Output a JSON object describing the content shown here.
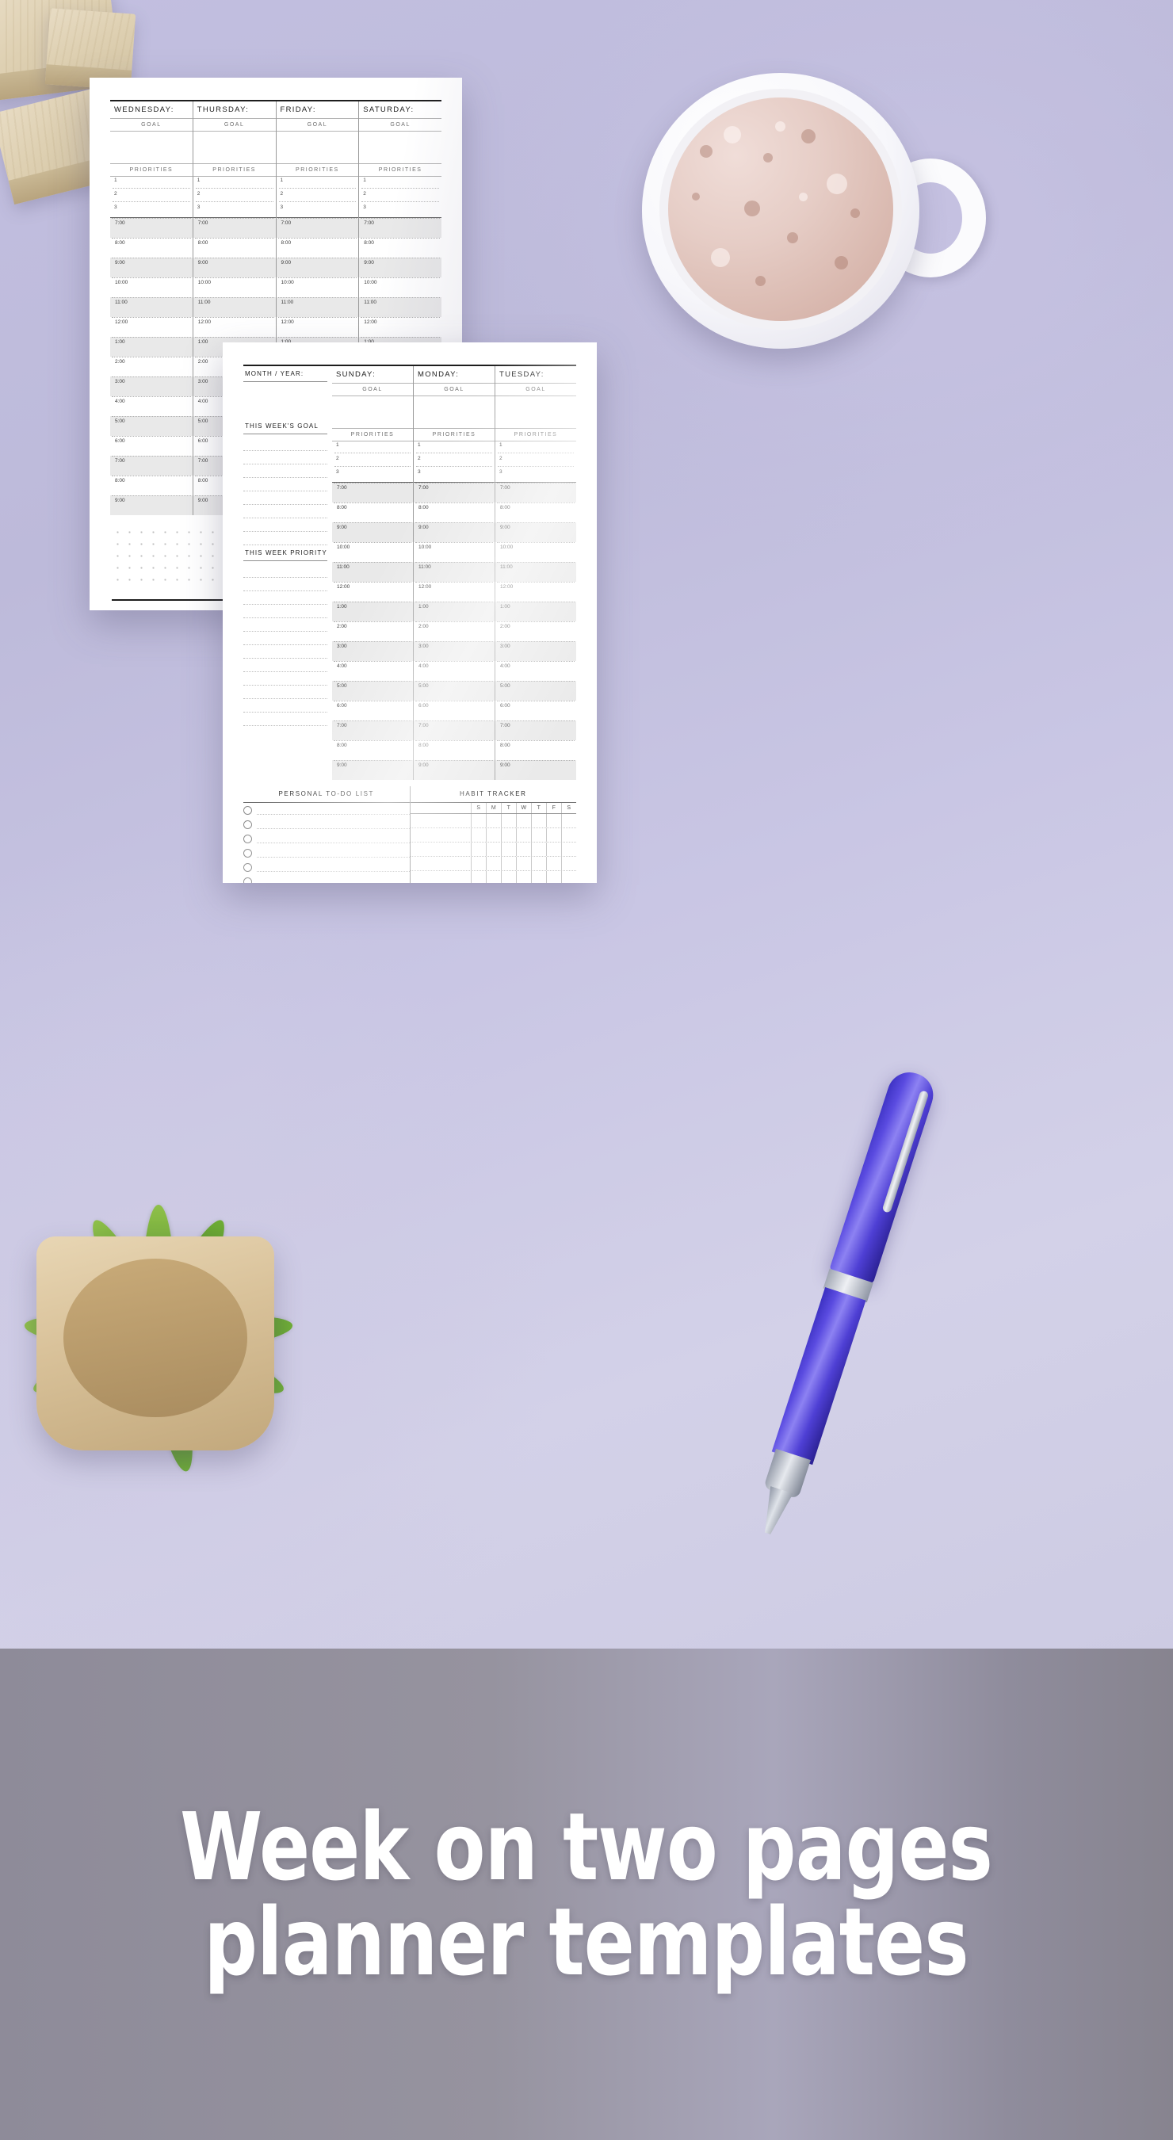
{
  "banner": {
    "line1": "Week on two pages",
    "line2": "planner templates"
  },
  "labels": {
    "goal": "GOAL",
    "priorities": "PRIORITIES",
    "priority_numbers": [
      "1",
      "2",
      "3"
    ]
  },
  "hours": [
    "7:00",
    "8:00",
    "9:00",
    "10:00",
    "11:00",
    "12:00",
    "1:00",
    "2:00",
    "3:00",
    "4:00",
    "5:00",
    "6:00",
    "7:00",
    "8:00",
    "9:00"
  ],
  "page1": {
    "days": [
      {
        "name": "WEDNESDAY:"
      },
      {
        "name": "THURSDAY:"
      },
      {
        "name": "FRIDAY:"
      },
      {
        "name": "SATURDAY:"
      }
    ]
  },
  "page2": {
    "header_label": "MONTH / YEAR:",
    "days": [
      {
        "name": "SUNDAY:"
      },
      {
        "name": "MONDAY:"
      },
      {
        "name": "TUESDAY:"
      }
    ],
    "sidebar": [
      {
        "title": "THIS WEEK'S GOAL",
        "lines": 8
      },
      {
        "title": "THIS WEEK PRIORITY",
        "lines": 12
      }
    ],
    "todo_title": "PERSONAL TO-DO LIST",
    "todo_rows": 6,
    "habit_title": "HABIT TRACKER",
    "habit_days": [
      "S",
      "M",
      "T",
      "W",
      "T",
      "F",
      "S"
    ],
    "habit_rows": 5
  },
  "colors": {
    "background": "#c2bfe0",
    "paper": "#ffffff",
    "ink": "#1d1d1d",
    "hour_shade": "#e9e9e9",
    "banner_text": "#ffffff",
    "pen_body": "#4e3fd4",
    "leaf_green": "#6aa534",
    "pot_wood": "#d9c29a"
  }
}
